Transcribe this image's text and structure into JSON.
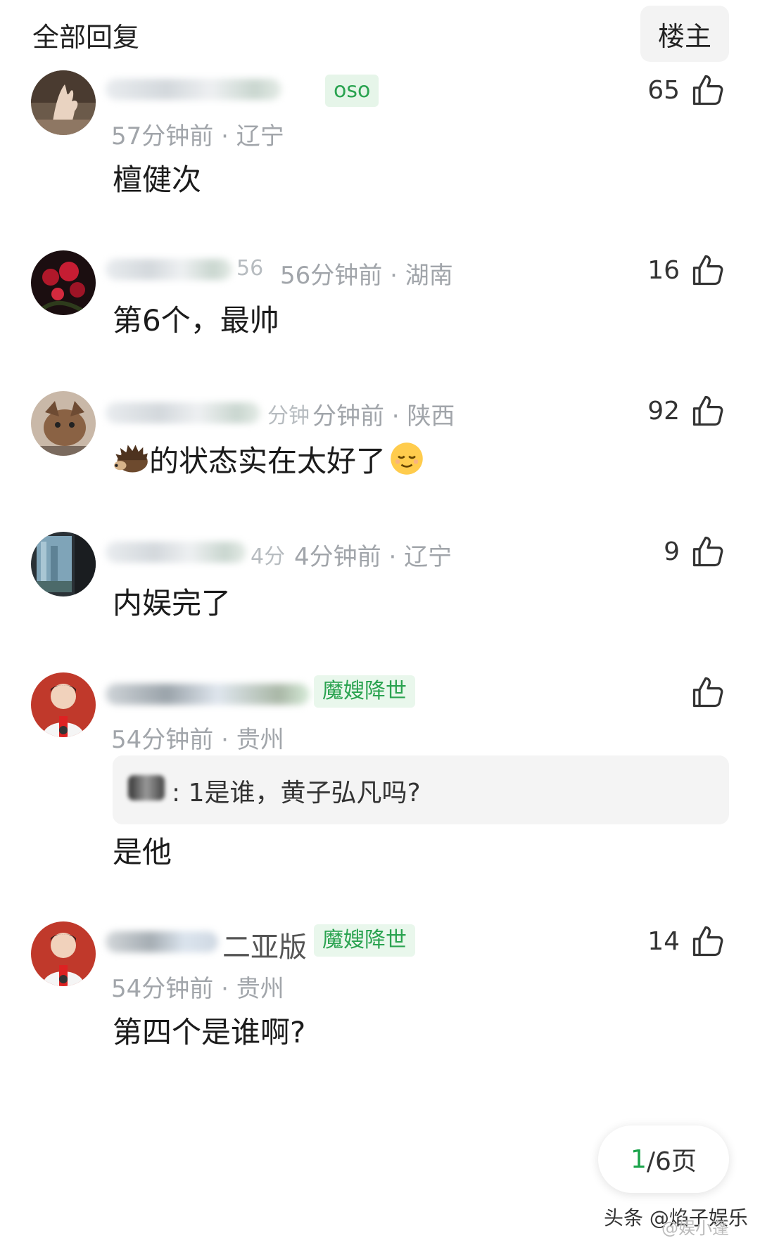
{
  "header": {
    "title": "全部回复",
    "op_button": "楼主"
  },
  "comments": [
    {
      "name_visible": "oso",
      "badge": "",
      "time": "57分钟前",
      "region": "辽宁",
      "text": "檀健次",
      "likes": "65"
    },
    {
      "name_visible": "56",
      "badge": "",
      "time": "56分钟前",
      "region": "湖南",
      "text": "第6个，最帅",
      "likes": "16"
    },
    {
      "name_visible": "分钟",
      "badge": "",
      "time": "分钟前",
      "region": "陕西",
      "text": "的状态实在太好了",
      "likes": "92"
    },
    {
      "name_visible": "4分",
      "badge": "",
      "time": "4分钟前",
      "region": "辽宁",
      "text": "内娱完了",
      "likes": "9"
    },
    {
      "name_visible": "",
      "badge": "魔嫂降世",
      "time": "54分钟前",
      "region": "贵州",
      "text": "是他",
      "likes": "",
      "quote": "1是谁，黄子弘凡吗?"
    },
    {
      "name_visible": "二亚版",
      "badge": "魔嫂降世",
      "time": "54分钟前",
      "region": "贵州",
      "text": "第四个是谁啊?",
      "likes": "14"
    }
  ],
  "pagination": {
    "current": "1",
    "rest": "/6页"
  },
  "watermark": {
    "main": "头条 @焰子娱乐",
    "sub": "@娱小蓬"
  },
  "colors": {
    "badge_green": "#2aa350",
    "page_current": "#1aa34a",
    "meta_gray": "#a1a5aa"
  },
  "icons": {
    "like": "thumbs-up-icon",
    "emoji_hedgehog": "hedgehog-icon",
    "emoji_relieved": "relieved-face-icon"
  }
}
